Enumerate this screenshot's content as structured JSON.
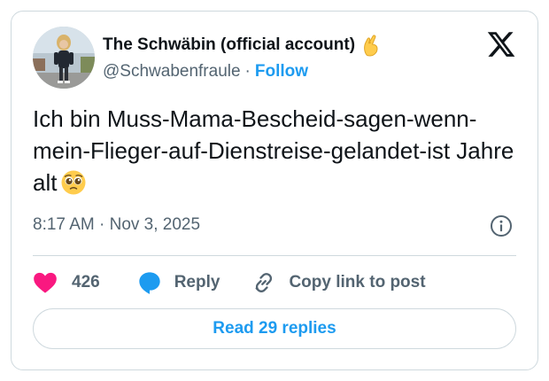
{
  "author": {
    "display_name": "The Schwäbin (official account)",
    "name_emoji": "pinching-hand-emoji",
    "handle": "@Schwabenfraule",
    "separator": "·",
    "follow_label": "Follow"
  },
  "tweet": {
    "text": "Ich bin Muss-Mama-Bescheid-sagen-wenn-mein-Flieger-auf-Dienstreise-gelandet-ist Jahre alt",
    "emoji": "pleading-face-emoji",
    "timestamp": "8:17 AM · Nov 3, 2025"
  },
  "actions": {
    "like_count": "426",
    "reply_label": "Reply",
    "copy_label": "Copy link to post"
  },
  "read_replies_label": "Read 29 replies",
  "colors": {
    "accent": "#1d9bf0",
    "like": "#f91880",
    "text_primary": "#0f1419",
    "text_secondary": "#536471",
    "border": "#cfd9de"
  },
  "icons": {
    "brand": "x-logo-icon",
    "info": "info-icon",
    "like": "heart-icon",
    "reply": "speech-bubble-icon",
    "copy": "link-icon"
  }
}
